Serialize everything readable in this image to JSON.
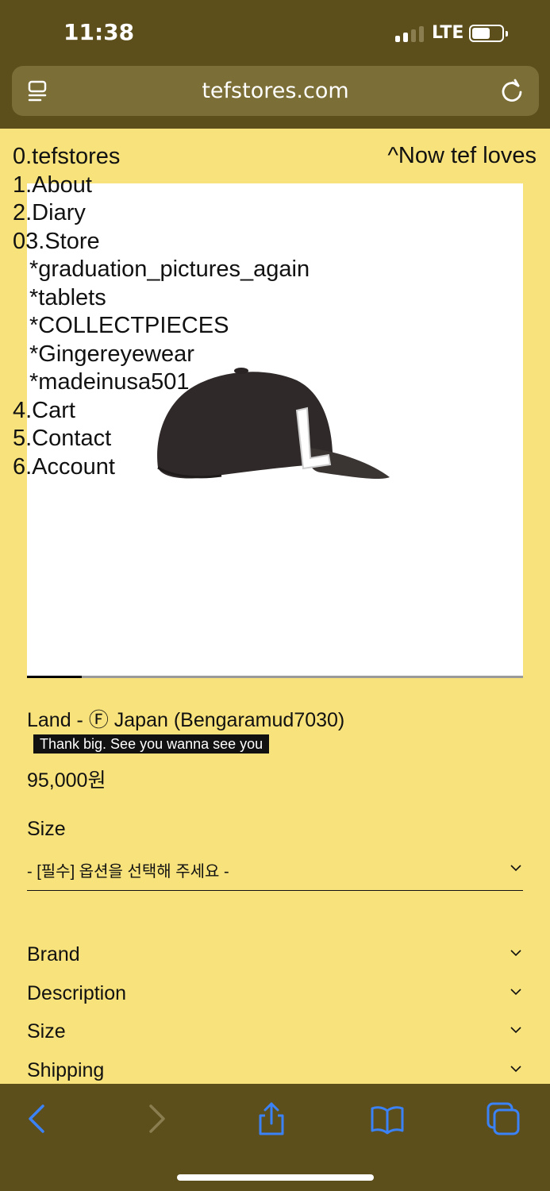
{
  "status_bar": {
    "time": "11:38",
    "network": "LTE"
  },
  "browser": {
    "url": "tefstores.com"
  },
  "nav": {
    "items": [
      {
        "label": "0.tefstores"
      },
      {
        "label": "1.About"
      },
      {
        "label": "2.Diary"
      },
      {
        "label": "03.Store"
      }
    ],
    "store_sub": [
      {
        "label": "*graduation_pictures_again"
      },
      {
        "label": "*tablets"
      },
      {
        "label": "*COLLECTPIECES"
      },
      {
        "label": "*Gingereyewear"
      },
      {
        "label": "*madeinusa501"
      }
    ],
    "items_after": [
      {
        "label": "4.Cart"
      },
      {
        "label": "5.Contact"
      },
      {
        "label": "6.Account"
      }
    ],
    "right_link": "^Now tef loves"
  },
  "product": {
    "image_icon": "cap-icon",
    "slider_progress": 0.11,
    "name": "Land - Ⓕ Japan (Bengaramud7030)",
    "tagline": "Thank big. See you wanna see you",
    "price": "95,000원",
    "size_label": "Size",
    "size_placeholder": "- [필수] 옵션을 선택해 주세요 -"
  },
  "accordion": [
    {
      "label": "Brand"
    },
    {
      "label": "Description"
    },
    {
      "label": "Size"
    },
    {
      "label": "Shipping"
    }
  ],
  "toolbar": {
    "icons": [
      "back-icon",
      "forward-icon",
      "share-icon",
      "bookmarks-icon",
      "tabs-icon"
    ],
    "accent": "#3b82f6"
  }
}
